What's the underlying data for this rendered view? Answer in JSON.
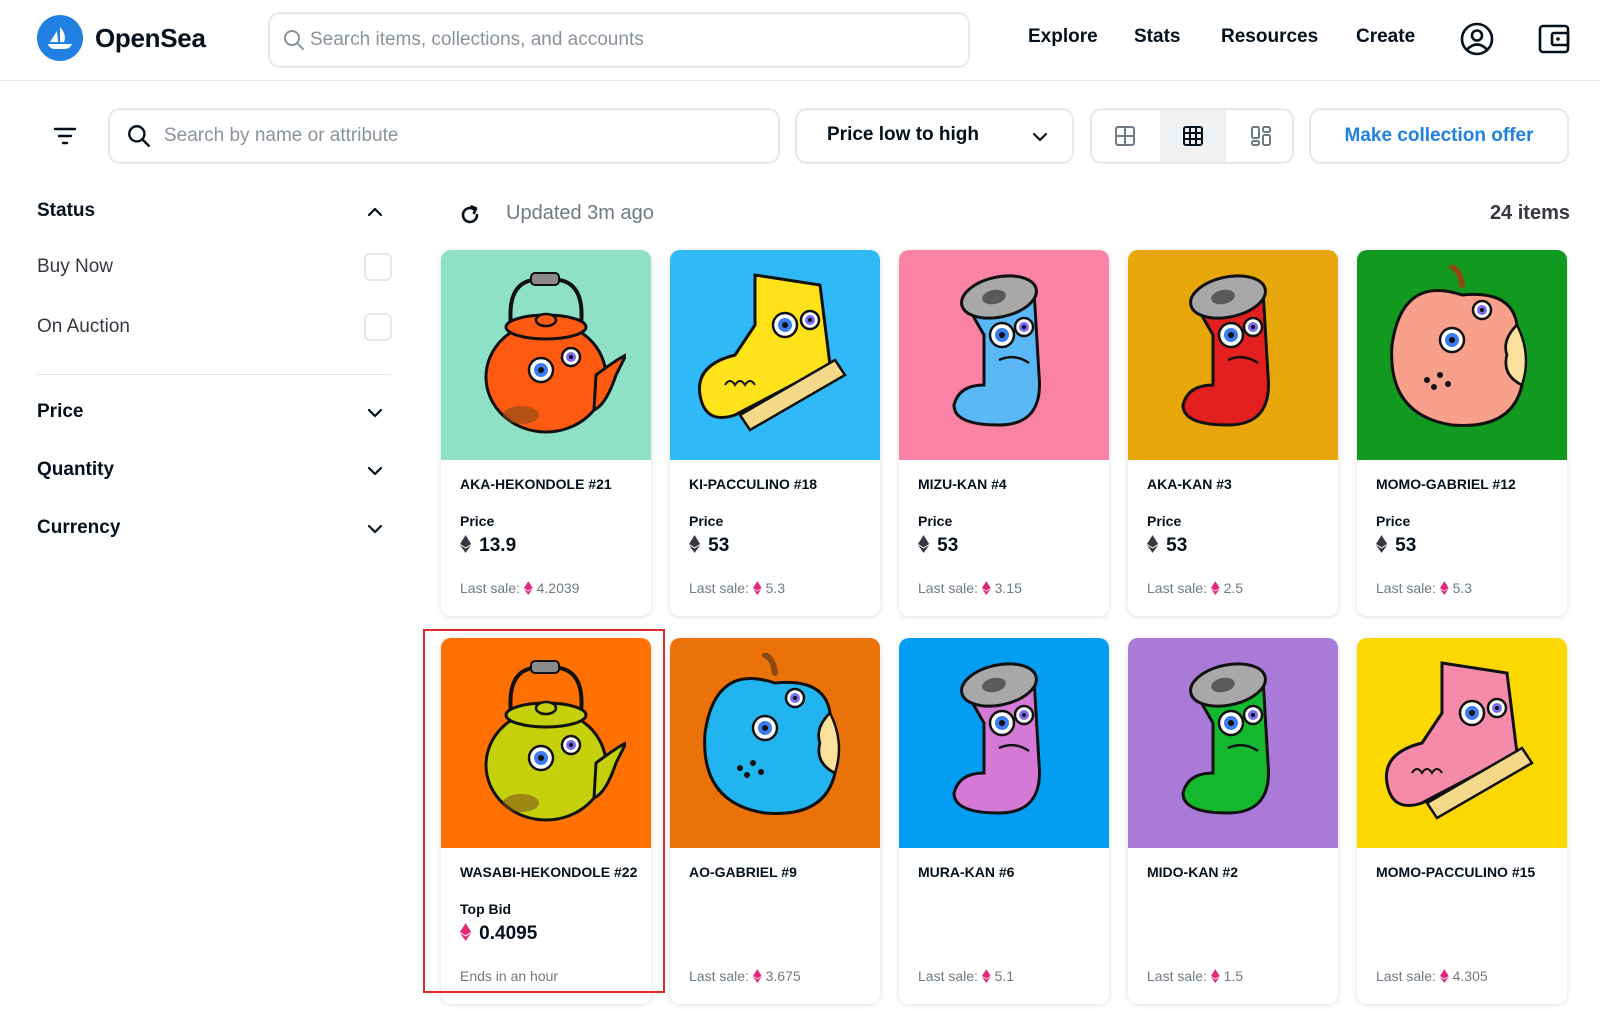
{
  "brand": {
    "name": "OpenSea",
    "logo_icon": "sailboat-logo-icon",
    "accent": "#2081e2"
  },
  "nav": {
    "search_placeholder": "Search items, collections, and accounts",
    "links": [
      "Explore",
      "Stats",
      "Resources",
      "Create"
    ],
    "icons": [
      "profile-icon",
      "wallet-icon"
    ]
  },
  "toolbar": {
    "filter_icon": "filter-icon",
    "search_placeholder": "Search by name or attribute",
    "sort_value": "Price low to high",
    "view_modes": [
      "large-grid-icon",
      "small-grid-icon",
      "mixed-grid-icon"
    ],
    "active_view": "small-grid-icon",
    "offer_button": "Make collection offer"
  },
  "sidebar": {
    "status": {
      "title": "Status",
      "options": [
        "Buy Now",
        "On Auction"
      ]
    },
    "sections": [
      "Price",
      "Quantity",
      "Currency"
    ]
  },
  "results": {
    "updated": "Updated 3m ago",
    "count": "24 items"
  },
  "cards": [
    {
      "name": "AKA-HEKONDOLE #21",
      "price_label": "Price",
      "price": "13.9",
      "footer_label": "Last sale:",
      "footer_value": "4.2039",
      "bg": "#8ee0c6",
      "object": "kettle",
      "color": "#ff5a12"
    },
    {
      "name": "KI-PACCULINO #18",
      "price_label": "Price",
      "price": "53",
      "footer_label": "Last sale:",
      "footer_value": "5.3",
      "bg": "#2fb9f6",
      "object": "boot",
      "color": "#ffe21a"
    },
    {
      "name": "MIZU-KAN #4",
      "price_label": "Price",
      "price": "53",
      "footer_label": "Last sale:",
      "footer_value": "3.15",
      "bg": "#f982a5",
      "object": "can",
      "color": "#5ab8f6"
    },
    {
      "name": "AKA-KAN #3",
      "price_label": "Price",
      "price": "53",
      "footer_label": "Last sale:",
      "footer_value": "2.5",
      "bg": "#e7a70a",
      "object": "can",
      "color": "#e41f1f"
    },
    {
      "name": "MOMO-GABRIEL #12",
      "price_label": "Price",
      "price": "53",
      "footer_label": "Last sale:",
      "footer_value": "5.3",
      "bg": "#119a1f",
      "object": "apple",
      "color": "#f9a08c"
    },
    {
      "name": "WASABI-HEKONDOLE #22",
      "price_label": "Top Bid",
      "price": "0.4095",
      "footer_label": "Ends in an hour",
      "footer_value": "",
      "bg": "#ff7000",
      "object": "kettle",
      "color": "#c4d10a"
    },
    {
      "name": "AO-GABRIEL #9",
      "price_label": "",
      "price": "",
      "footer_label": "Last sale:",
      "footer_value": "3.675",
      "bg": "#ea7208",
      "object": "apple",
      "color": "#22b4ee"
    },
    {
      "name": "MURA-KAN #6",
      "price_label": "",
      "price": "",
      "footer_label": "Last sale:",
      "footer_value": "5.1",
      "bg": "#039ef4",
      "object": "can",
      "color": "#d47ad6"
    },
    {
      "name": "MIDO-KAN #2",
      "price_label": "",
      "price": "",
      "footer_label": "Last sale:",
      "footer_value": "1.5",
      "bg": "#a97ad8",
      "object": "can",
      "color": "#14b930"
    },
    {
      "name": "MOMO-PACCULINO #15",
      "price_label": "",
      "price": "",
      "footer_label": "Last sale:",
      "footer_value": "4.305",
      "bg": "#fbd800",
      "object": "boot",
      "color": "#f58aaa"
    }
  ],
  "colors": {
    "weth": "#e0287c",
    "eth": "#353840",
    "highlight": "#e0282e"
  }
}
